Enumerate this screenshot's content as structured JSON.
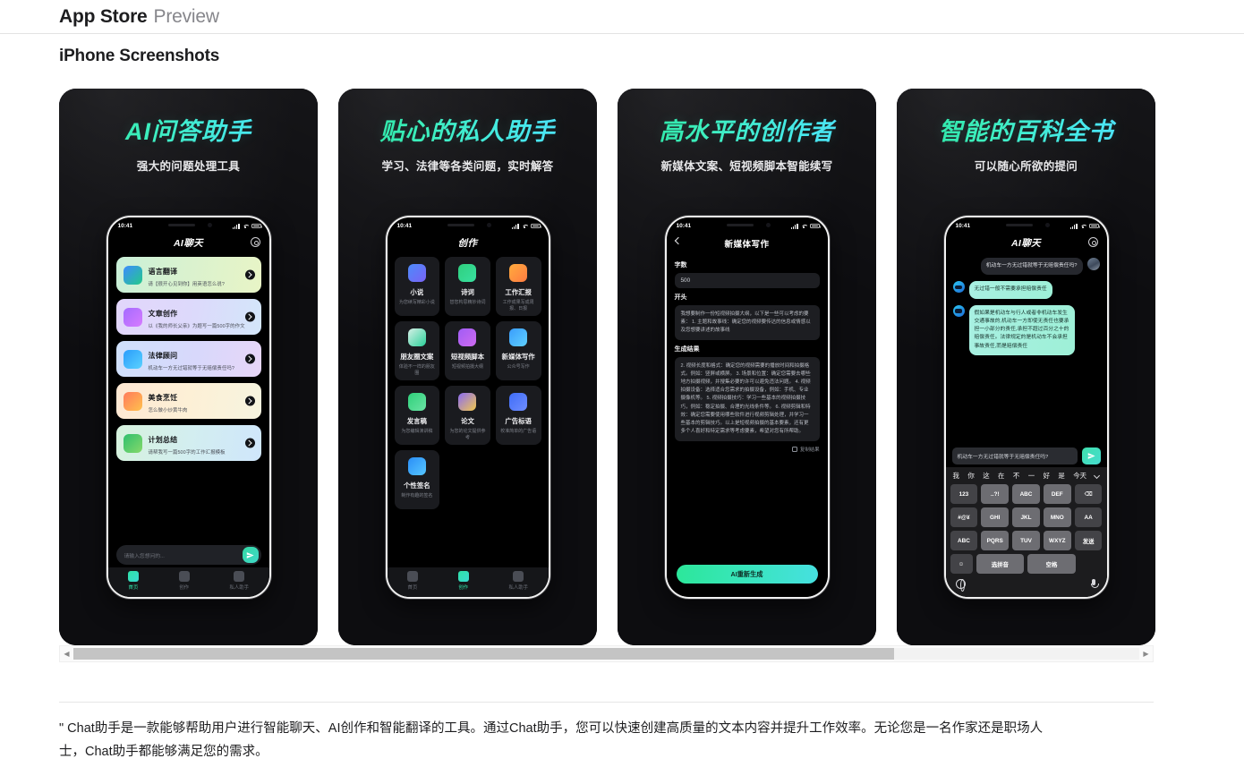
{
  "header": {
    "brand": "App Store",
    "preview_label": "Preview",
    "section_title": "iPhone Screenshots"
  },
  "screenshots": [
    {
      "title": "AI问答助手",
      "subtitle": "强大的问题处理工具",
      "phone": {
        "status_time": "10:41",
        "nav_title": "AI聊天",
        "nav_gear_icon": "gear-icon",
        "cards": [
          {
            "title": "语言翻译",
            "desc": "请【很开心见到你】用英语怎么说?",
            "icon": "translate-icon"
          },
          {
            "title": "文章创作",
            "desc": "以《我的师长父亲》为题写一篇500字的作文",
            "icon": "pencil-note-icon"
          },
          {
            "title": "法律顾问",
            "desc": "机动车一方无过错就等于无赔偿责任吗?",
            "icon": "law-icon"
          },
          {
            "title": "美食烹饪",
            "desc": "怎么做小炒黄牛肉",
            "icon": "food-icon"
          },
          {
            "title": "计划总结",
            "desc": "请帮我写一篇500字的工作汇报模板",
            "icon": "plan-icon"
          }
        ],
        "input_placeholder": "请输入您想问的...",
        "send_icon": "send-icon",
        "tabs": [
          {
            "label": "首页",
            "icon": "home-icon",
            "active": true
          },
          {
            "label": "创作",
            "icon": "create-icon",
            "active": false
          },
          {
            "label": "私人助手",
            "icon": "assistant-icon",
            "active": false
          }
        ]
      }
    },
    {
      "title": "贴心的私人助手",
      "subtitle": "学习、法律等各类问题，实时解答",
      "phone": {
        "status_time": "10:41",
        "nav_title": "创作",
        "grid": [
          {
            "title": "小说",
            "desc": "为您续写精彩小说"
          },
          {
            "title": "诗词",
            "desc": "替您构思精妙诗词"
          },
          {
            "title": "工作汇报",
            "desc": "工作成果写成周报、日报"
          },
          {
            "title": "朋友圈文案",
            "desc": "体验不一样的朋友圈"
          },
          {
            "title": "短视频脚本",
            "desc": "短视频拍摄大纲"
          },
          {
            "title": "新媒体写作",
            "desc": "公众号写作"
          },
          {
            "title": "发言稿",
            "desc": "为您编辑演讲稿"
          },
          {
            "title": "论文",
            "desc": "为您的论文提供参考"
          },
          {
            "title": "广告标语",
            "desc": "校准简单的广告语"
          },
          {
            "title": "个性签名",
            "desc": "制作有趣的签名"
          }
        ],
        "tabs": [
          {
            "label": "首页",
            "icon": "home-icon",
            "active": false
          },
          {
            "label": "创作",
            "icon": "create-icon",
            "active": true
          },
          {
            "label": "私人助手",
            "icon": "assistant-icon",
            "active": false
          }
        ]
      }
    },
    {
      "title": "高水平的创作者",
      "subtitle": "新媒体文案、短视频脚本智能续写",
      "phone": {
        "status_time": "10:41",
        "nav_title": "新媒体写作",
        "back_icon": "chevron-left-icon",
        "word_count_label": "字数",
        "word_count_value": "500",
        "opening_label": "开头",
        "opening_text": "我想要制作一份短视频拍摄大纲，以下是一些可以考虑的要素：\n1. 主题和故事线：确定您的视频要传达的信息或情感以及您想要讲述的故事线",
        "result_label": "生成结果",
        "result_text": "2. 视频长度和格式：确定您的视频需要的播放时间和拍摄格式。例如：竖屏或横屏。\n3. 场景和位置：确定您需要去哪些地方拍摄视频，并搜集必要的许可以避免违法问题。\n4. 视频拍摄设备：选择适合您需求的拍摄设备，例如：手机、专业摄像机等。\n5. 视频拍摄技巧：学习一些基本的视频拍摄技巧，例如：稳定拍摄、合理的光线条件等。\n6. 视频剪辑和特效：确定您需要使用哪些软件进行视频剪辑处理，并学习一些基本的剪辑技巧。以上是短视频拍摄的基本要素，还有更多个人喜好和特定需求等考虑要素，希望对您有所帮助。",
        "copy_label": "复制结果",
        "copy_icon": "copy-icon",
        "regen_label": "AI重新生成"
      }
    },
    {
      "title": "智能的百科全书",
      "subtitle": "可以随心所欲的提问",
      "phone": {
        "status_time": "10:41",
        "nav_title": "AI聊天",
        "nav_gear_icon": "gear-icon",
        "messages": [
          {
            "from": "user",
            "text": "机动车一方无过错就等于无赔偿责任吗?"
          },
          {
            "from": "ai",
            "text": "无过错一般不需要承担赔偿责任"
          },
          {
            "from": "ai",
            "text": "假如果是机动车与行人或者非机动车发生交通事故的,机动车一方即使无责任也要承担一小部分的责任,承担不超过百分之十的赔偿责任。法律规定的是机动车不会承担事故责任,而是赔偿责任"
          }
        ],
        "input_value": "机动车一方无过错就等于无赔偿责任吗?",
        "send_icon": "send-icon",
        "keyboard": {
          "suggestions": [
            "我",
            "你",
            "这",
            "在",
            "不",
            "一",
            "好",
            "是",
            "今天"
          ],
          "expand_icon": "chevron-down-icon",
          "rows": [
            [
              "123",
              "..?!",
              "ABC",
              "DEF",
              "⌫"
            ],
            [
              "#@¥",
              "GHI",
              "JKL",
              "MNO",
              "AA"
            ],
            [
              "ABC",
              "PQRS",
              "TUV",
              "WXYZ",
              "发送"
            ],
            [
              "☺",
              "选拼音",
              "空格"
            ]
          ],
          "globe_icon": "globe-icon",
          "mic_icon": "mic-icon"
        }
      }
    }
  ],
  "scrollbar": {
    "left_arrow_icon": "chevron-left-icon",
    "right_arrow_icon": "chevron-right-icon",
    "thumb_percent": "77"
  },
  "description": "\" Chat助手是一款能够帮助用户进行智能聊天、AI创作和智能翻译的工具。通过Chat助手，您可以快速创建高质量的文本内容并提升工作效率。无论您是一名作家还是职场人士，Chat助手都能够满足您的需求。"
}
